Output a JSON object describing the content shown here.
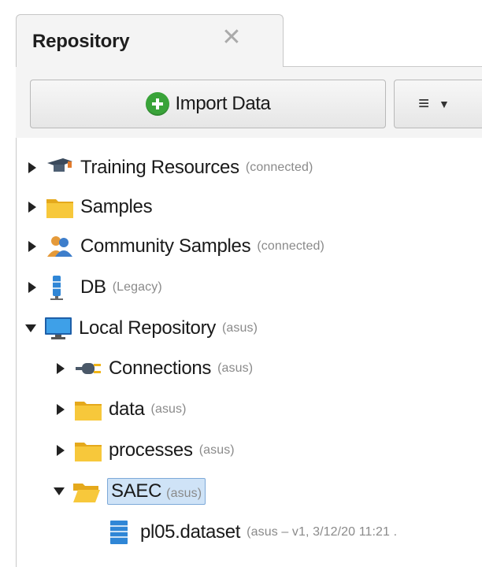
{
  "tab": {
    "title": "Repository",
    "close_glyph": "✕"
  },
  "toolbar": {
    "import_label": "Import Data",
    "menu_glyph": "≡",
    "dropdown_glyph": "▼"
  },
  "tree": {
    "items": [
      {
        "label": "Training Resources",
        "meta": "(connected)",
        "icon": "graduation-cap-icon",
        "expanded": false
      },
      {
        "label": "Samples",
        "meta": "",
        "icon": "folder-icon",
        "expanded": false
      },
      {
        "label": "Community Samples",
        "meta": "(connected)",
        "icon": "users-icon",
        "expanded": false
      },
      {
        "label": "DB",
        "meta": "(Legacy)",
        "icon": "database-icon",
        "expanded": false
      },
      {
        "label": "Local Repository",
        "meta": "(asus)",
        "icon": "monitor-icon",
        "expanded": true
      },
      {
        "label": "Connections",
        "meta": "(asus)",
        "icon": "plug-icon",
        "expanded": false
      },
      {
        "label": "data",
        "meta": "(asus)",
        "icon": "folder-icon",
        "expanded": false
      },
      {
        "label": "processes",
        "meta": "(asus)",
        "icon": "folder-icon",
        "expanded": false
      },
      {
        "label": "SAEC",
        "meta": "(asus)",
        "icon": "open-folder-icon",
        "expanded": true,
        "selected": true
      },
      {
        "label": "pl05.dataset",
        "meta": "(asus – v1, 3/12/20 11:21 .",
        "icon": "dataset-icon"
      }
    ]
  },
  "colors": {
    "accent_green": "#39a339",
    "folder_yellow": "#f5c32c",
    "selection_bg": "#cfe3f7",
    "meta_gray": "#8a8a8a"
  }
}
